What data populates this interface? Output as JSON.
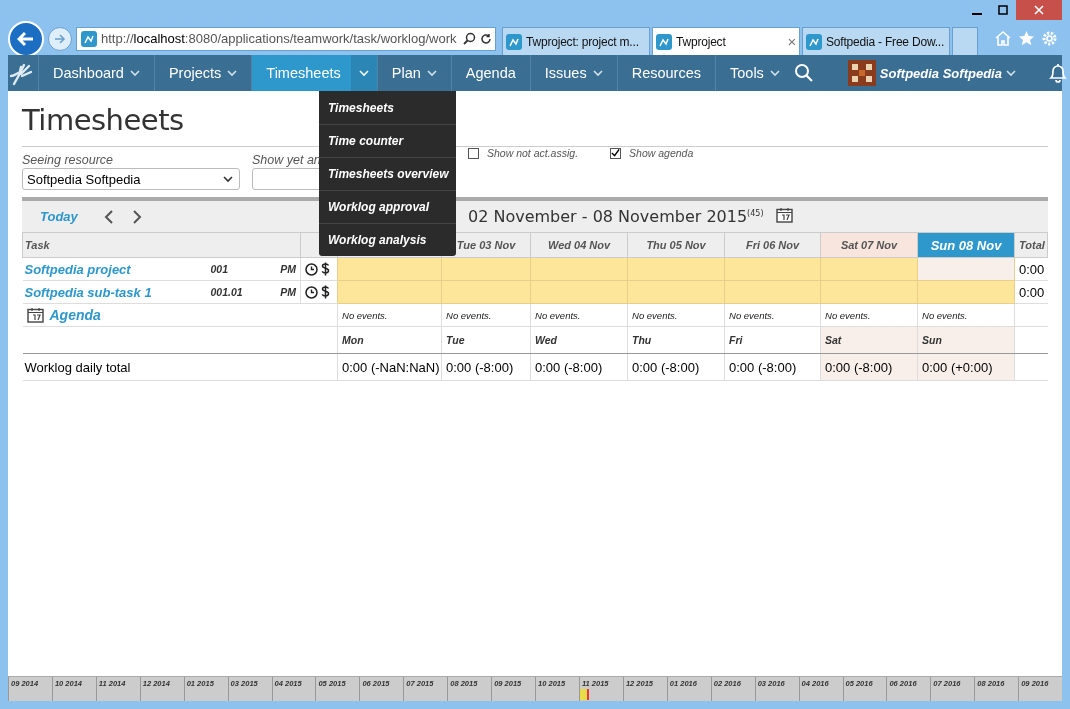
{
  "browser": {
    "address_prefix": "http://",
    "address_host": "localhost",
    "address_rest": ":8080/applications/teamwork/task/worklog/work",
    "tabs": [
      {
        "label": "Twproject: project m...",
        "selected": false,
        "closable": false
      },
      {
        "label": "Twproject",
        "selected": true,
        "closable": true
      },
      {
        "label": "Softpedia - Free Dow...",
        "selected": false,
        "closable": false
      }
    ],
    "close_tab": "×"
  },
  "nav": {
    "items": [
      {
        "label": "Dashboard",
        "caret": true,
        "selected": false
      },
      {
        "label": "Projects",
        "caret": true,
        "selected": false
      },
      {
        "label": "Timesheets",
        "caret": true,
        "selected": true
      },
      {
        "label": "Plan",
        "caret": true,
        "selected": false
      },
      {
        "label": "Agenda",
        "caret": false,
        "selected": false
      },
      {
        "label": "Issues",
        "caret": true,
        "selected": false
      },
      {
        "label": "Resources",
        "caret": false,
        "selected": false
      },
      {
        "label": "Tools",
        "caret": true,
        "selected": false
      }
    ],
    "user": "Softpedia Softpedia"
  },
  "menu": {
    "items": [
      "Timesheets",
      "Time counter",
      "Timesheets overview",
      "Worklog approval",
      "Worklog analysis"
    ]
  },
  "page": {
    "title": "Timesheets",
    "resource_label": "Seeing resource",
    "resource_value": "Softpedia Softpedia",
    "second_label": "Show yet an",
    "checkboxes": [
      {
        "label": "Show not act.assig.",
        "checked": false
      },
      {
        "label": "Show agenda",
        "checked": true
      }
    ],
    "today": "Today",
    "period": "02 November - 08 November 2015",
    "week": "(45)"
  },
  "table": {
    "task_header": "Task",
    "total_header": "Total",
    "days": [
      {
        "kind": "weekday"
      },
      {
        "label": "Tue 03 Nov",
        "kind": "weekday"
      },
      {
        "label": "Wed 04 Nov",
        "kind": "weekday"
      },
      {
        "label": "Thu 05 Nov",
        "kind": "weekday"
      },
      {
        "label": "Fri 06 Nov",
        "kind": "weekday"
      },
      {
        "label": "Sat 07 Nov",
        "kind": "holiday"
      },
      {
        "label": "Sun 08 Nov",
        "kind": "today"
      }
    ],
    "rows": [
      {
        "name": "Softpedia project",
        "code": "001",
        "role": "PM",
        "cells": [
          {
            "open": true
          },
          {
            "open": true
          },
          {
            "open": true
          },
          {
            "open": true
          },
          {
            "open": true
          },
          {
            "open": true
          },
          {
            "open": false
          }
        ],
        "total": "0:00"
      },
      {
        "name": "Softpedia sub-task 1",
        "code": "001.01",
        "role": "PM",
        "cells": [
          {
            "open": true
          },
          {
            "open": true
          },
          {
            "open": true
          },
          {
            "open": true
          },
          {
            "open": true
          },
          {
            "open": true
          },
          {
            "open": true
          }
        ],
        "total": "0:00"
      }
    ],
    "agenda_label": "Agenda",
    "agenda": [
      "No events.",
      "No events.",
      "No events.",
      "No events.",
      "No events.",
      "No events.",
      "No events."
    ],
    "short_days": [
      "Mon",
      "Tue",
      "Wed",
      "Thu",
      "Fri",
      "Sat",
      "Sun"
    ],
    "totals_label": "Worklog daily total",
    "totals": [
      "0:00 (-NaN:NaN)",
      "0:00 (-8:00)",
      "0:00 (-8:00)",
      "0:00 (-8:00)",
      "0:00 (-8:00)",
      "0:00 (-8:00)",
      "0:00 (+0:00)"
    ]
  },
  "timeline": {
    "months": [
      {
        "label": "09 2014",
        "current": false
      },
      {
        "label": "10 2014",
        "current": false
      },
      {
        "label": "11 2014",
        "current": false
      },
      {
        "label": "12 2014",
        "current": false
      },
      {
        "label": "01 2015",
        "current": false
      },
      {
        "label": "03 2015",
        "current": false
      },
      {
        "label": "04 2015",
        "current": false
      },
      {
        "label": "05 2015",
        "current": false
      },
      {
        "label": "06 2015",
        "current": false
      },
      {
        "label": "07 2015",
        "current": false
      },
      {
        "label": "08 2015",
        "current": false
      },
      {
        "label": "09 2015",
        "current": false
      },
      {
        "label": "10 2015",
        "current": false
      },
      {
        "label": "11 2015",
        "current": true
      },
      {
        "label": "12 2015",
        "current": false
      },
      {
        "label": "01 2016",
        "current": false
      },
      {
        "label": "02 2016",
        "current": false
      },
      {
        "label": "03 2016",
        "current": false
      },
      {
        "label": "04 2016",
        "current": false
      },
      {
        "label": "05 2016",
        "current": false
      },
      {
        "label": "06 2016",
        "current": false
      },
      {
        "label": "07 2016",
        "current": false
      },
      {
        "label": "08 2016",
        "current": false
      },
      {
        "label": "09 2016",
        "current": false
      }
    ]
  }
}
